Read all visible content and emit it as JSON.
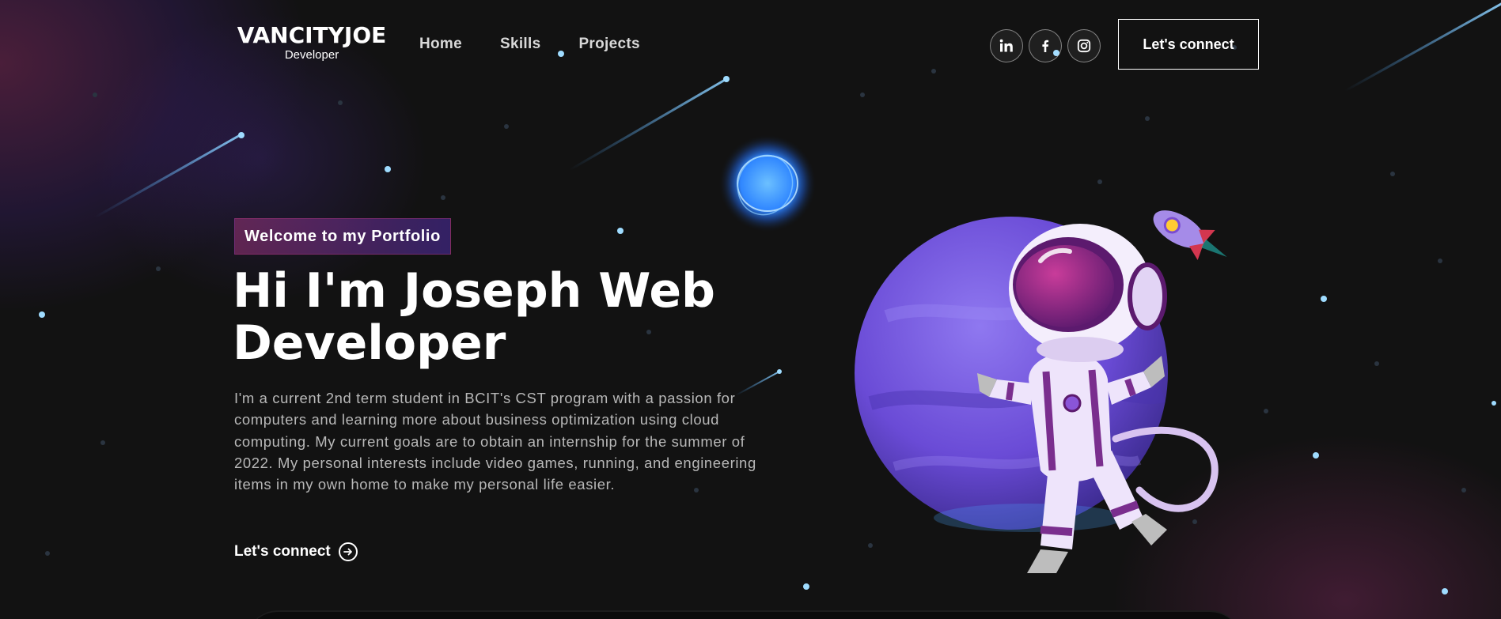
{
  "nav": {
    "logo_title": "VANCITYJOE",
    "logo_subtitle": "Developer",
    "links": [
      {
        "label": "Home"
      },
      {
        "label": "Skills"
      },
      {
        "label": "Projects"
      }
    ],
    "social_icons": [
      "linkedin-icon",
      "facebook-icon",
      "instagram-icon"
    ],
    "connect_label": "Let's connect"
  },
  "hero": {
    "tagline": "Welcome to my Portfolio",
    "title_line1": "Hi I'm Joseph Web",
    "title_line2": "Developer",
    "description": "I'm a current 2nd term student in BCIT's CST program with a passion for computers and learning more about business optimization using cloud computing. My current goals are to obtain an internship for the summer of 2022. My personal interests include video games, running, and engineering items in my own home to make my personal life easier.",
    "cta_label": "Let's connect"
  },
  "colors": {
    "background": "#121212",
    "tagline_gradient_start": "#AA367C",
    "tagline_gradient_end": "#4A2FBD",
    "planet": "#6a4bd6",
    "orb": "#4aa8ff"
  }
}
